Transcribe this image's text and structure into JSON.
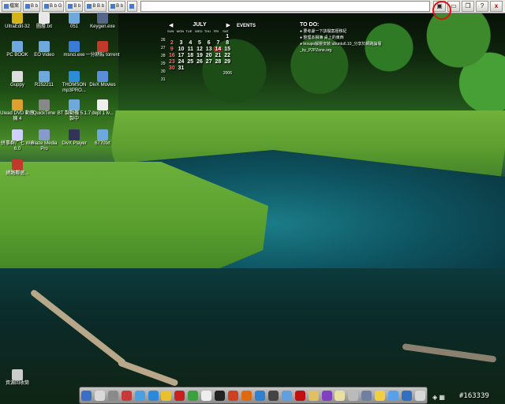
{
  "toolbar": {
    "buttons": [
      "檔案",
      "B  b",
      "B  b  G",
      "B  b",
      "B  B  b",
      "B  b"
    ],
    "icon_buttons": [
      "window-icon",
      "minimize-icon",
      "restore-icon",
      "help-icon",
      "close-icon"
    ],
    "help_label": "?",
    "close_label": "x"
  },
  "desktop_icons": [
    {
      "label": "UltraEdit-32",
      "color": "#d4b21a"
    },
    {
      "label": "圖層.txt",
      "color": "#e8e8e8"
    },
    {
      "label": "051",
      "color": "#6fa8dc"
    },
    {
      "label": "Keygen.exe",
      "color": "#556688"
    },
    {
      "label": "PC BOOK",
      "color": "#6fa8dc"
    },
    {
      "label": "EO Video",
      "color": "#6fa8dc"
    },
    {
      "label": "msnci.exe",
      "color": "#3a7bd5"
    },
    {
      "label": "一分耕耘 torrent",
      "color": "#c0392b"
    },
    {
      "label": "Guppy",
      "color": "#ddd"
    },
    {
      "label": "R252211",
      "color": "#6fa8dc"
    },
    {
      "label": "THOMSON mp3PRO...",
      "color": "#2d8cd6"
    },
    {
      "label": "DivX Movies",
      "color": "#5a8fd8"
    },
    {
      "label": "Ulead DVD 動態機 4",
      "color": "#e0a030"
    },
    {
      "label": "QuickTime",
      "color": "#888"
    },
    {
      "label": "BT 製動機 5.1.7 製中",
      "color": "#6fa8dc"
    },
    {
      "label": "dept 1 lv...",
      "color": "#eee"
    },
    {
      "label": "拼事群广七 Wie 6.0",
      "color": "#d0d0ff"
    },
    {
      "label": "Blaze Media Pro",
      "color": "#8899cc"
    },
    {
      "label": "DivX Player",
      "color": "#335"
    },
    {
      "label": "6770txt",
      "color": "#6fa8dc"
    },
    {
      "label": "網路鄰居...",
      "color": "#c0392b"
    },
    {
      "label": "資源回收筒",
      "color": "#ccc"
    }
  ],
  "calendar": {
    "month": "JULY",
    "weekdays": [
      "SUN",
      "MON",
      "TUE",
      "WED",
      "THU",
      "FRI",
      "SAT"
    ],
    "weeks": [
      "26",
      "27",
      "28",
      "29",
      "30",
      "31"
    ],
    "days": [
      "",
      "",
      "",
      "",
      "",
      "",
      "1",
      "2",
      "3",
      "4",
      "5",
      "6",
      "7",
      "8",
      "9",
      "10",
      "11",
      "12",
      "13",
      "14",
      "15",
      "16",
      "17",
      "18",
      "19",
      "20",
      "21",
      "22",
      "23",
      "24",
      "25",
      "26",
      "27",
      "28",
      "29",
      "30",
      "31",
      "",
      "",
      "",
      "",
      ""
    ],
    "today": "14",
    "year": "2006",
    "events_label": "EVENTS"
  },
  "todo": {
    "title": "TO DO:",
    "items": [
      "要考慮一下該檔案經移紀",
      "整理本相簿 桌上的東西",
      "lesupo解壓安裝 ubuntu6.10_分享於網路論壇_by_P2PZone.org"
    ]
  },
  "dock": {
    "icons": [
      "monitor-icon",
      "cd-icon",
      "tools-icon",
      "paint-icon",
      "finder-icon",
      "globe-icon",
      "music-icon",
      "pdf-icon",
      "chrome-icon",
      "eject-icon",
      "star-icon",
      "mail-icon",
      "firefox-icon",
      "alarm-icon",
      "clock-icon",
      "photo-icon",
      "red-icon",
      "folder-icon",
      "image-icon",
      "pencil-icon",
      "trash-icon",
      "wrench-icon",
      "smile-icon",
      "chat-icon",
      "help-icon",
      "bin-icon"
    ]
  },
  "counter": "#163339"
}
